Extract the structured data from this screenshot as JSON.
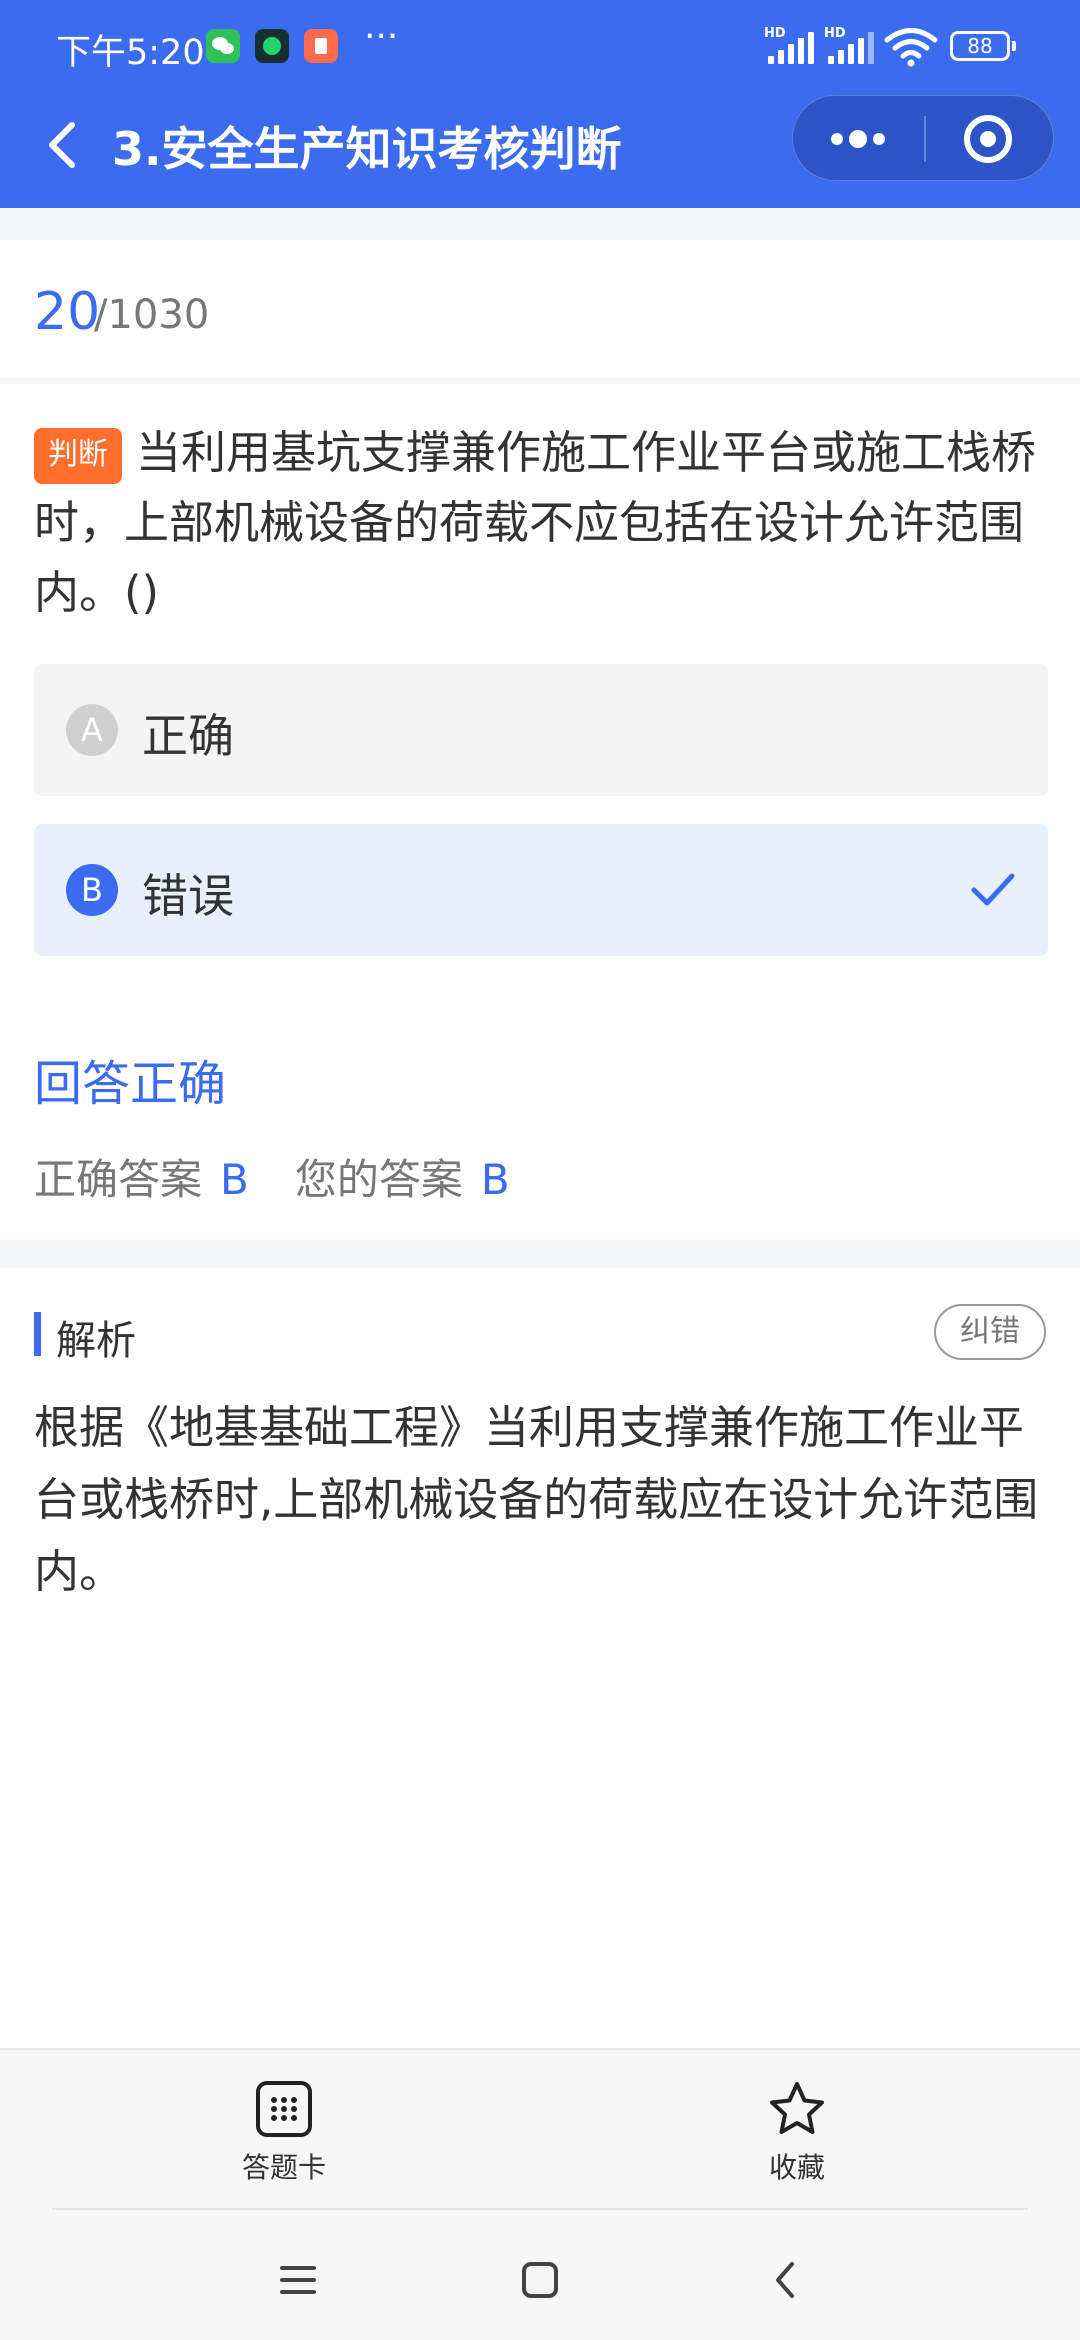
{
  "status_bar": {
    "time": "下午5:20",
    "signal_label": "HD",
    "battery": "88"
  },
  "nav": {
    "title": "3.安全生产知识考核判断"
  },
  "progress": {
    "current": "20",
    "total": "/1030"
  },
  "question": {
    "type_tag": "判断",
    "text": "当利用基坑支撑兼作施工作业平台或施工栈桥时，上部机械设备的荷载不应包括在设计允许范围内。()",
    "options": [
      {
        "letter": "A",
        "text": "正确",
        "selected": false
      },
      {
        "letter": "B",
        "text": "错误",
        "selected": true
      }
    ]
  },
  "result": {
    "status": "回答正确",
    "correct_label": "正确答案",
    "correct_value": "B",
    "yours_label": "您的答案",
    "yours_value": "B"
  },
  "analysis": {
    "title": "解析",
    "report_button": "纠错",
    "text": "根据《地基基础工程》当利用支撑兼作施工作业平台或栈桥时,上部机械设备的荷载应在设计允许范围内。"
  },
  "toolbar": {
    "answer_card_label": "答题卡",
    "favorite_label": "收藏"
  },
  "colors": {
    "primary": "#3b6cf0",
    "tag": "#ff6e2c",
    "selected_bg": "#e8effd"
  }
}
